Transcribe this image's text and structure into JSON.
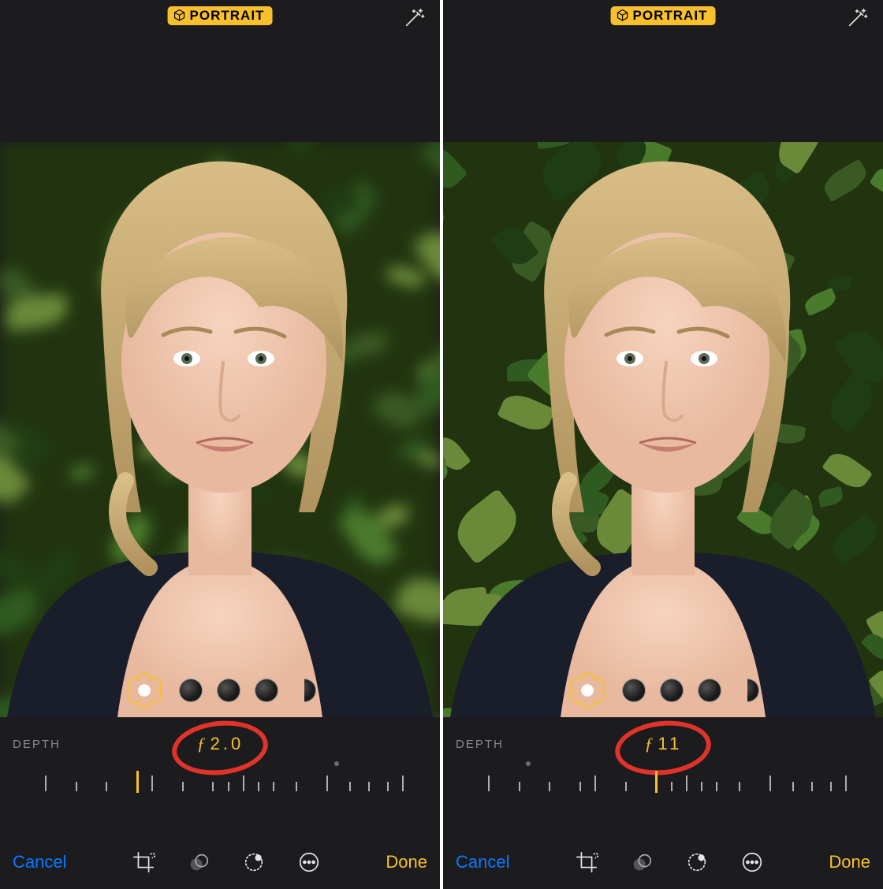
{
  "panes": [
    {
      "mode_badge": "PORTRAIT",
      "depth_label": "DEPTH",
      "f_stop_display": "2.0",
      "slider": {
        "dot_pct": 80,
        "indicator_pct": 28
      },
      "bg_blur": true,
      "cancel_label": "Cancel",
      "done_label": "Done"
    },
    {
      "mode_badge": "PORTRAIT",
      "depth_label": "DEPTH",
      "f_stop_display": "11",
      "slider": {
        "dot_pct": 14,
        "indicator_pct": 48
      },
      "bg_blur": false,
      "cancel_label": "Cancel",
      "done_label": "Done"
    }
  ],
  "lighting_options_count": 4,
  "tick_positions_pct": [
    4,
    12,
    20,
    28,
    32,
    40,
    48,
    52,
    56,
    60,
    64,
    70,
    78,
    84,
    89,
    94,
    98
  ],
  "tick_tall_indices": [
    0,
    4,
    8,
    12,
    16
  ]
}
